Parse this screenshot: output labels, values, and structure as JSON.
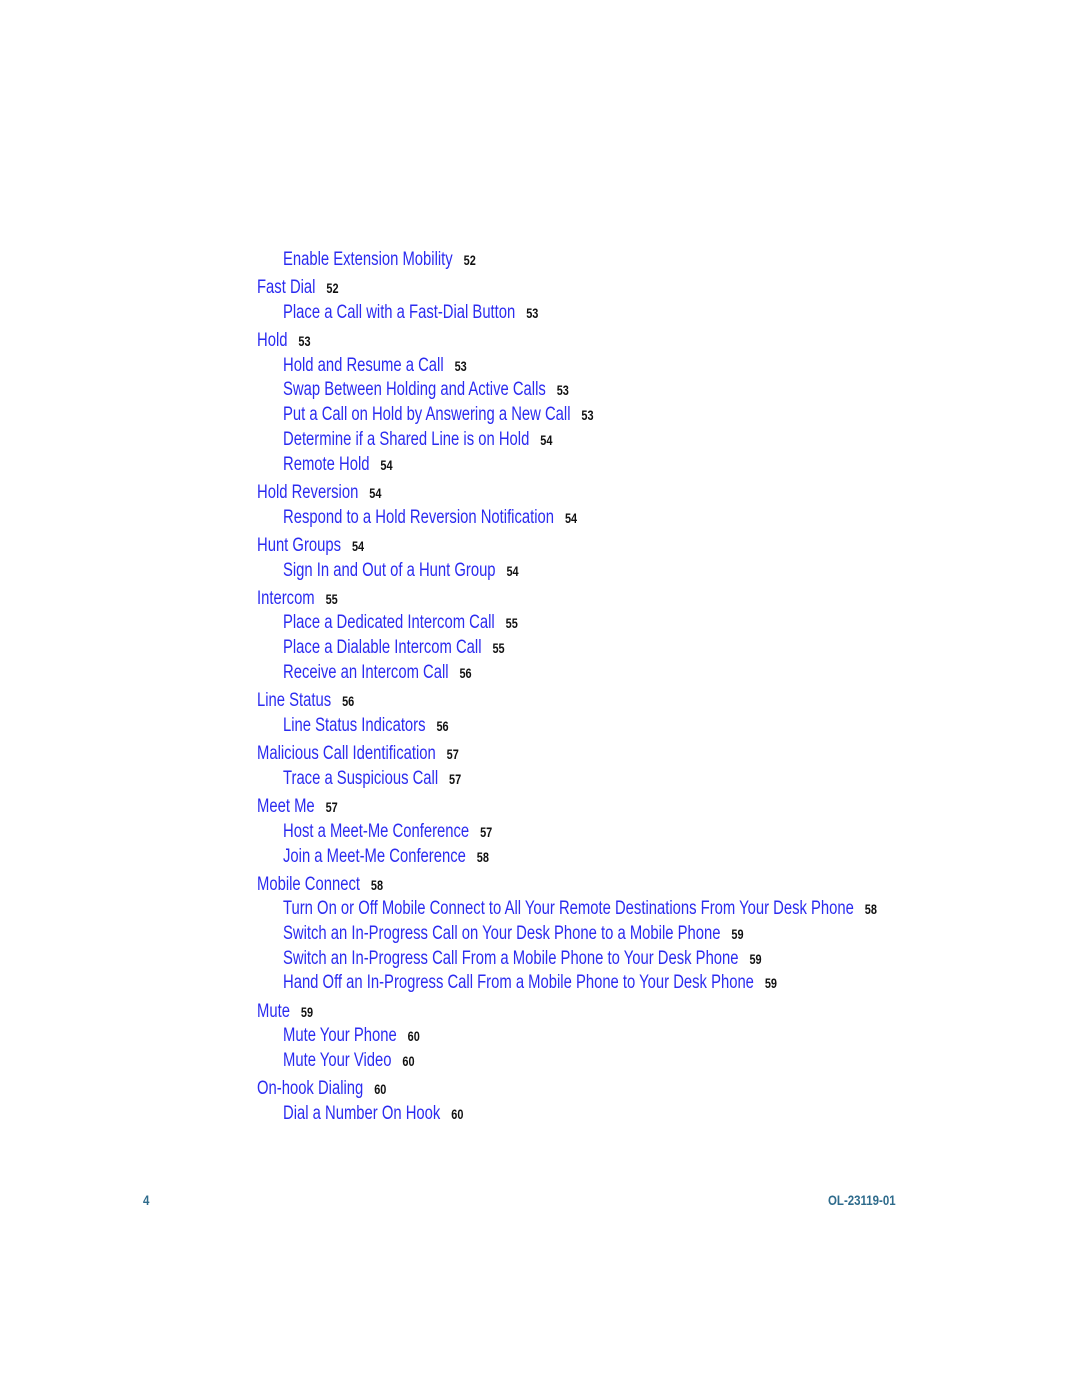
{
  "toc": {
    "entries": [
      {
        "level": 2,
        "title": "Enable Extension Mobility",
        "page": "52"
      },
      {
        "level": 1,
        "title": "Fast Dial",
        "page": "52"
      },
      {
        "level": 2,
        "title": "Place a Call with a Fast-Dial Button",
        "page": "53"
      },
      {
        "level": 1,
        "title": "Hold",
        "page": "53"
      },
      {
        "level": 2,
        "title": "Hold and Resume a Call",
        "page": "53"
      },
      {
        "level": 2,
        "title": "Swap Between Holding and Active Calls",
        "page": "53"
      },
      {
        "level": 2,
        "title": "Put a Call on Hold by Answering a New Call",
        "page": "53"
      },
      {
        "level": 2,
        "title": "Determine if a Shared Line is on Hold",
        "page": "54"
      },
      {
        "level": 2,
        "title": "Remote Hold",
        "page": "54"
      },
      {
        "level": 1,
        "title": "Hold Reversion",
        "page": "54"
      },
      {
        "level": 2,
        "title": "Respond to a Hold Reversion Notification",
        "page": "54"
      },
      {
        "level": 1,
        "title": "Hunt Groups",
        "page": "54"
      },
      {
        "level": 2,
        "title": "Sign In and Out of a Hunt Group",
        "page": "54"
      },
      {
        "level": 1,
        "title": "Intercom",
        "page": "55"
      },
      {
        "level": 2,
        "title": "Place a Dedicated Intercom Call",
        "page": "55"
      },
      {
        "level": 2,
        "title": "Place a Dialable Intercom Call",
        "page": "55"
      },
      {
        "level": 2,
        "title": "Receive an Intercom Call",
        "page": "56"
      },
      {
        "level": 1,
        "title": "Line Status",
        "page": "56"
      },
      {
        "level": 2,
        "title": "Line Status Indicators",
        "page": "56"
      },
      {
        "level": 1,
        "title": "Malicious Call Identification",
        "page": "57"
      },
      {
        "level": 2,
        "title": "Trace a Suspicious Call",
        "page": "57"
      },
      {
        "level": 1,
        "title": "Meet Me",
        "page": "57"
      },
      {
        "level": 2,
        "title": "Host a Meet-Me Conference",
        "page": "57"
      },
      {
        "level": 2,
        "title": "Join a Meet-Me Conference",
        "page": "58"
      },
      {
        "level": 1,
        "title": "Mobile Connect",
        "page": "58"
      },
      {
        "level": 2,
        "title": "Turn On or Off Mobile Connect to All Your Remote Destinations From Your Desk Phone",
        "page": "58"
      },
      {
        "level": 2,
        "title": "Switch an In-Progress Call on Your Desk Phone to a Mobile Phone",
        "page": "59"
      },
      {
        "level": 2,
        "title": "Switch an In-Progress Call From a Mobile Phone to Your Desk Phone",
        "page": "59"
      },
      {
        "level": 2,
        "title": "Hand Off an In-Progress Call From a Mobile Phone to Your Desk Phone",
        "page": "59"
      },
      {
        "level": 1,
        "title": "Mute",
        "page": "59"
      },
      {
        "level": 2,
        "title": "Mute Your Phone",
        "page": "60"
      },
      {
        "level": 2,
        "title": "Mute Your Video",
        "page": "60"
      },
      {
        "level": 1,
        "title": "On-hook Dialing",
        "page": "60"
      },
      {
        "level": 2,
        "title": "Dial a Number On Hook",
        "page": "60"
      }
    ]
  },
  "footer": {
    "page_number": "4",
    "doc_number": "OL-23119-01"
  },
  "colors": {
    "link": "#2b2bf0",
    "page_number": "#111111",
    "footer": "#2e6b8c"
  }
}
